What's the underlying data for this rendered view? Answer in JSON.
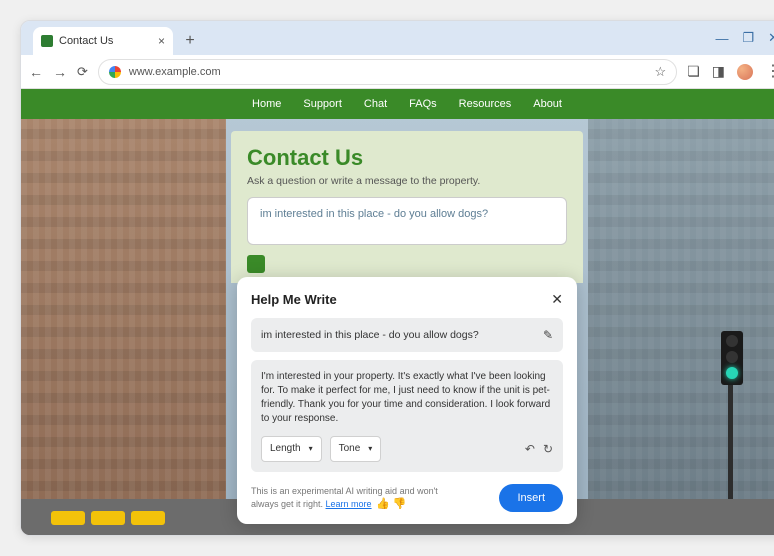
{
  "browser": {
    "tab_title": "Contact Us",
    "url": "www.example.com",
    "window_minimize": "—",
    "window_restore": "❐",
    "window_close": "✕"
  },
  "nav": {
    "items": [
      "Home",
      "Support",
      "Chat",
      "FAQs",
      "Resources",
      "About"
    ]
  },
  "page": {
    "heading": "Contact Us",
    "subheading": "Ask a question or write a message to the property.",
    "message_value": "im interested in this place - do you allow dogs?"
  },
  "modal": {
    "title": "Help Me Write",
    "prompt": "im interested in this place - do you allow dogs?",
    "generated": "I'm interested in your property. It's exactly what I've been looking for. To make it perfect for me, I just need to know if the unit is pet-friendly. Thank you for your time and consideration. I look forward to your response.",
    "dropdowns": {
      "length": "Length",
      "tone": "Tone"
    },
    "disclaimer_pre": "This is an experimental AI writing aid and won't always get it right. ",
    "learn_more": "Learn more",
    "insert_label": "Insert"
  }
}
